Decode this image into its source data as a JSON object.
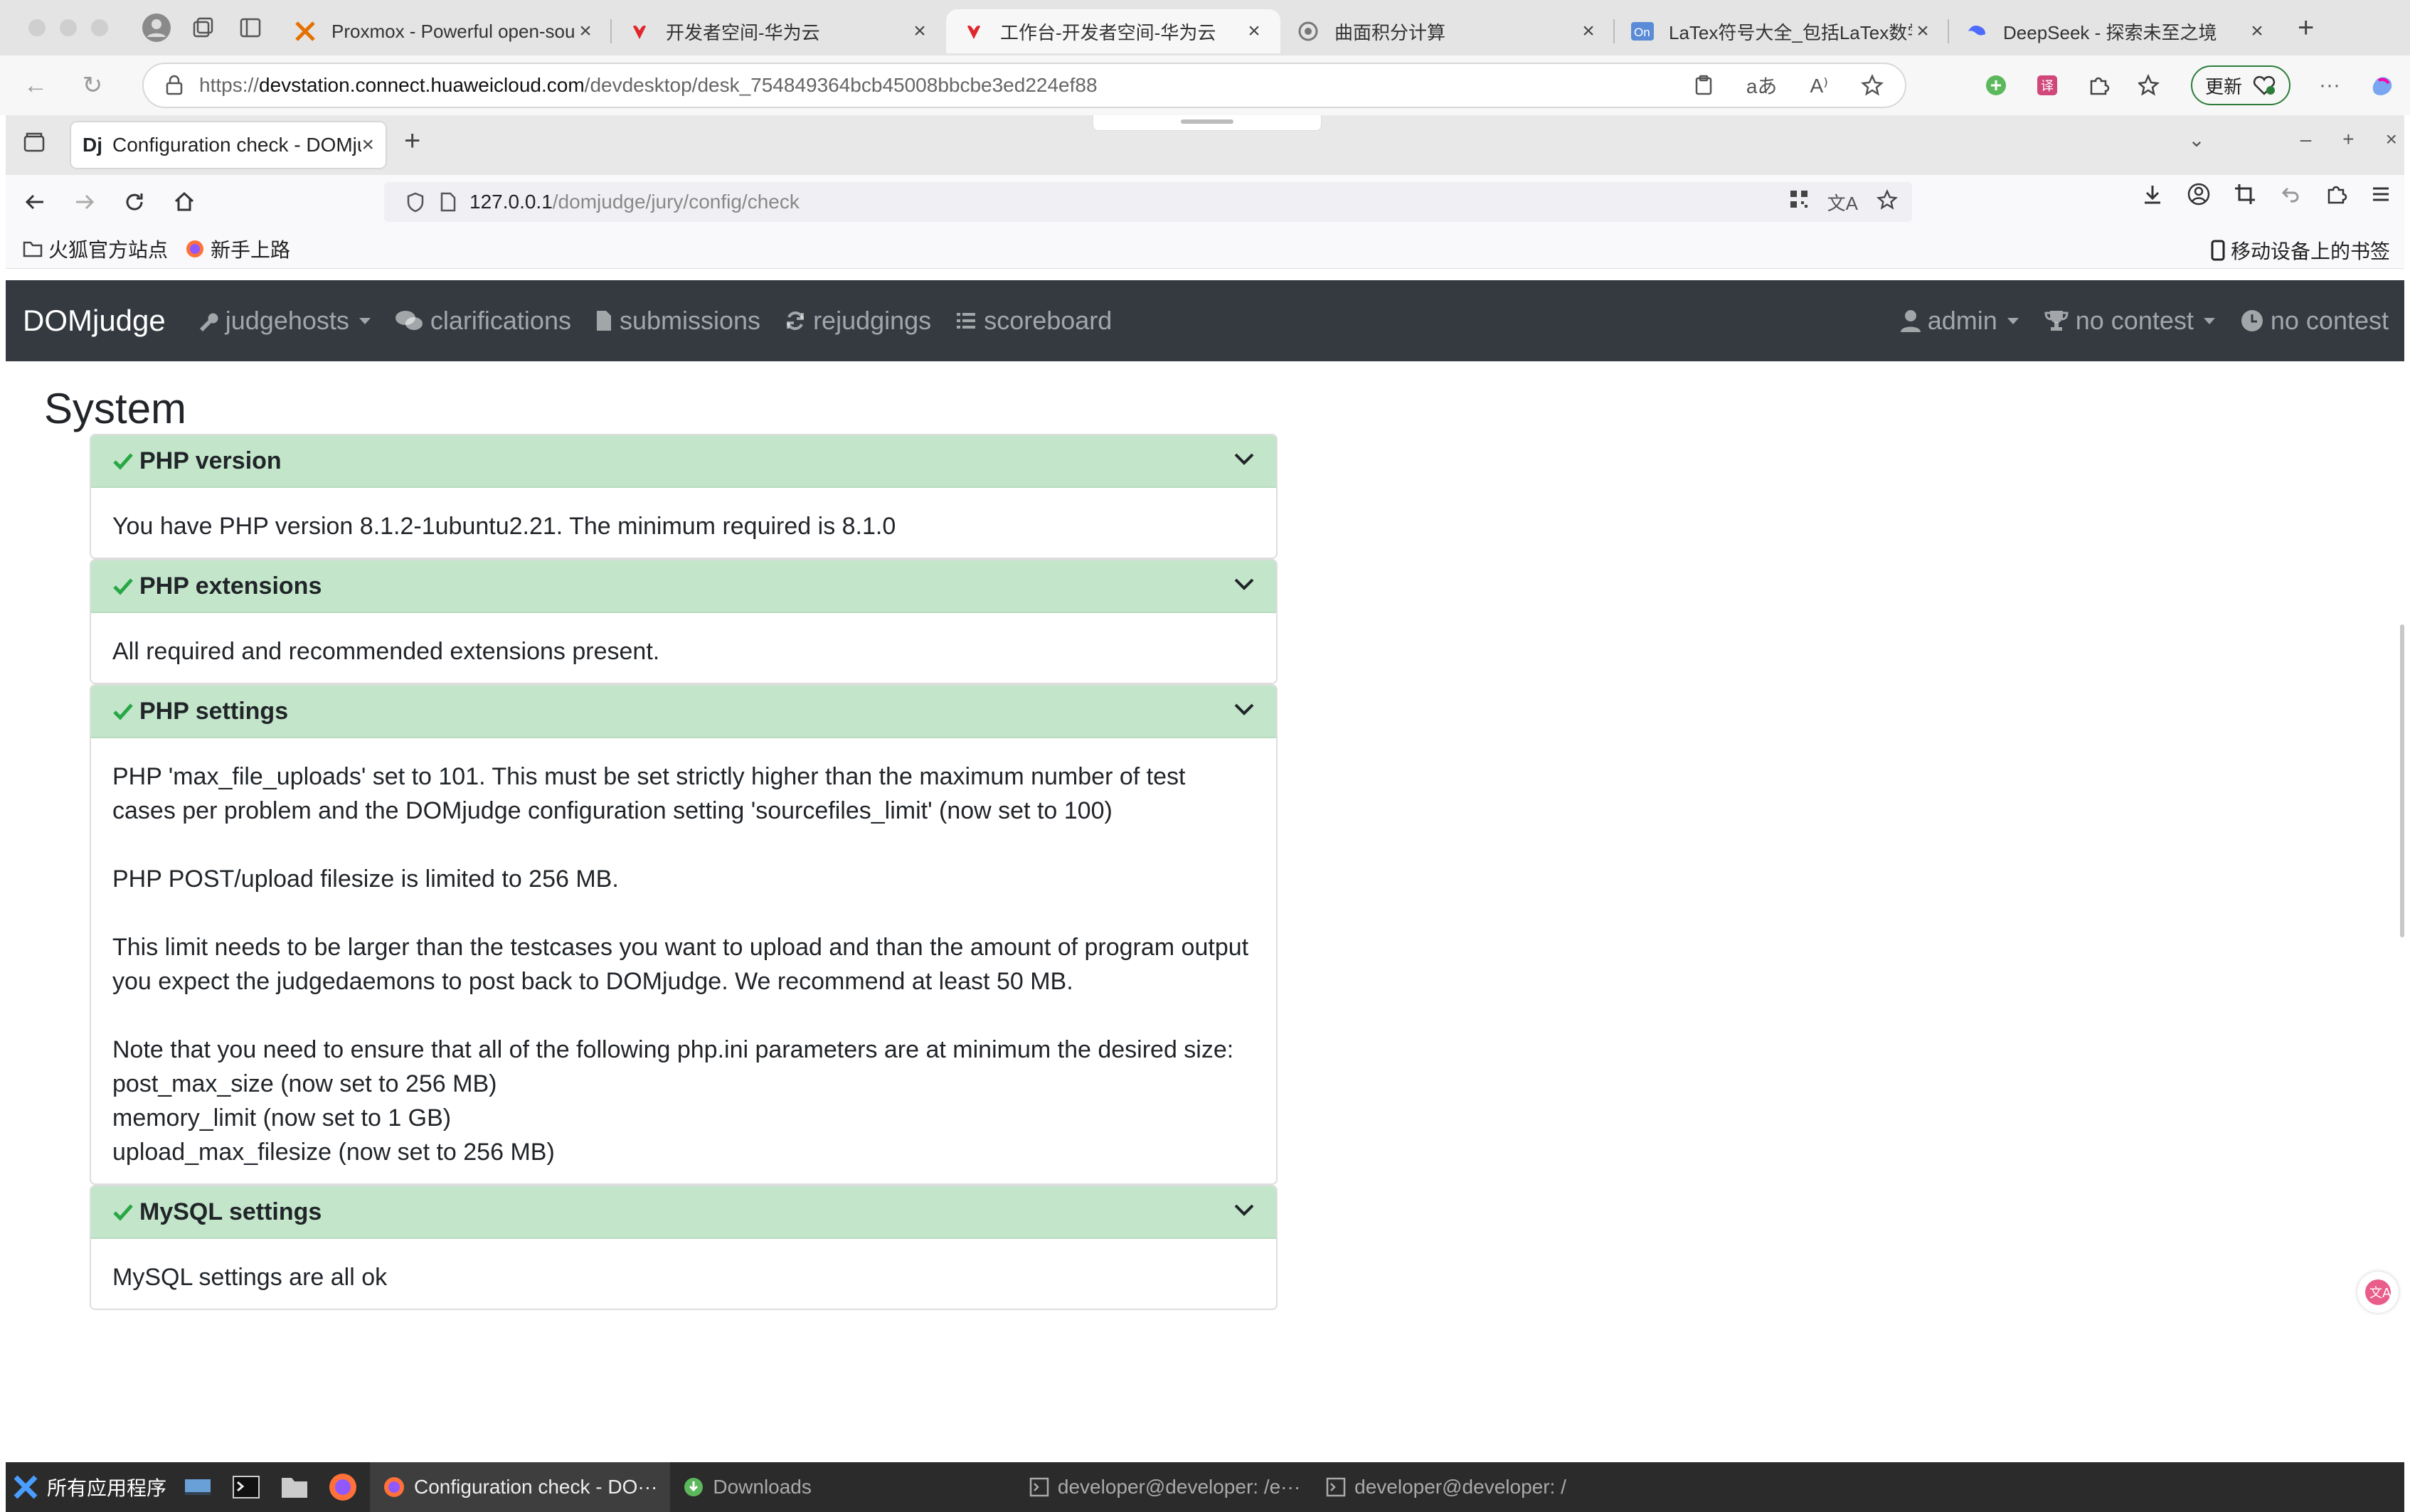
{
  "edge": {
    "tabs": [
      {
        "title": "Proxmox - Powerful open-sour",
        "icon": "proxmox-icon",
        "active": false
      },
      {
        "title": "开发者空间-华为云",
        "icon": "huawei-icon",
        "active": false
      },
      {
        "title": "工作台-开发者空间-华为云",
        "icon": "huawei-icon",
        "active": true
      },
      {
        "title": "曲面积分计算",
        "icon": "chat-icon",
        "active": false
      },
      {
        "title": "LaTex符号大全_包括LaTex数学符",
        "icon": "on-icon",
        "active": false
      },
      {
        "title": "DeepSeek - 探索未至之境",
        "icon": "deepseek-icon",
        "active": false
      }
    ],
    "url_prefix": "https://",
    "url_host": "devstation.connect.huaweicloud.com",
    "url_path": "/devdesktop/desk_754849364bcb45008bbcbe3ed224ef88",
    "update_label": "更新"
  },
  "firefox": {
    "tab_title": "Configuration check - DOMjudge",
    "tab_icon_text": "Dj",
    "url_host": "127.0.0.1",
    "url_path": "/domjudge/jury/config/check",
    "bookmarks": [
      "火狐官方站点",
      "新手上路"
    ],
    "mobile_bookmarks": "移动设备上的书签"
  },
  "domjudge": {
    "brand": "DOMjudge",
    "nav": [
      {
        "label": "judgehosts",
        "icon": "wrench-icon",
        "dropdown": true
      },
      {
        "label": "clarifications",
        "icon": "comments-icon",
        "dropdown": false
      },
      {
        "label": "submissions",
        "icon": "file-icon",
        "dropdown": false
      },
      {
        "label": "rejudgings",
        "icon": "sync-icon",
        "dropdown": false
      },
      {
        "label": "scoreboard",
        "icon": "list-icon",
        "dropdown": false
      }
    ],
    "user": "admin",
    "contest_select": "no contest",
    "contest_status": "no contest"
  },
  "page": {
    "heading": "System",
    "checks": [
      {
        "title": "PHP version",
        "status": "ok",
        "paragraphs": [
          [
            "You have PHP version 8.1.2-1ubuntu2.21. The minimum required is 8.1.0"
          ]
        ]
      },
      {
        "title": "PHP extensions",
        "status": "ok",
        "paragraphs": [
          [
            "All required and recommended extensions present."
          ]
        ]
      },
      {
        "title": "PHP settings",
        "status": "ok",
        "paragraphs": [
          [
            "PHP 'max_file_uploads' set to 101. This must be set strictly higher than the maximum number of test cases per problem and the DOMjudge configuration setting 'sourcefiles_limit' (now set to 100)"
          ],
          [
            "PHP POST/upload filesize is limited to 256 MB."
          ],
          [
            "This limit needs to be larger than the testcases you want to upload and than the amount of program output you expect the judgedaemons to post back to DOMjudge. We recommend at least 50 MB."
          ],
          [
            "Note that you need to ensure that all of the following php.ini parameters are at minimum the desired size:",
            "post_max_size (now set to 256 MB)",
            "memory_limit (now set to 1 GB)",
            "upload_max_filesize (now set to 256 MB)"
          ]
        ]
      },
      {
        "title": "MySQL settings",
        "status": "ok",
        "paragraphs": [
          [
            "MySQL settings are all ok"
          ]
        ]
      }
    ]
  },
  "taskbar": {
    "start_label": "所有应用程序",
    "tasks": [
      {
        "label": "Configuration check - DO···",
        "icon": "firefox-icon",
        "active": true
      },
      {
        "label": "Downloads",
        "icon": "download-icon",
        "active": false
      },
      {
        "label": "developer@developer: /e···",
        "icon": "terminal-icon",
        "active": false
      },
      {
        "label": "developer@developer: /",
        "icon": "terminal-icon",
        "active": false
      }
    ]
  },
  "colors": {
    "navbar_bg": "#343a40",
    "card_header_success": "#c3e6cb",
    "edge_update_border": "#2d7d3a"
  }
}
